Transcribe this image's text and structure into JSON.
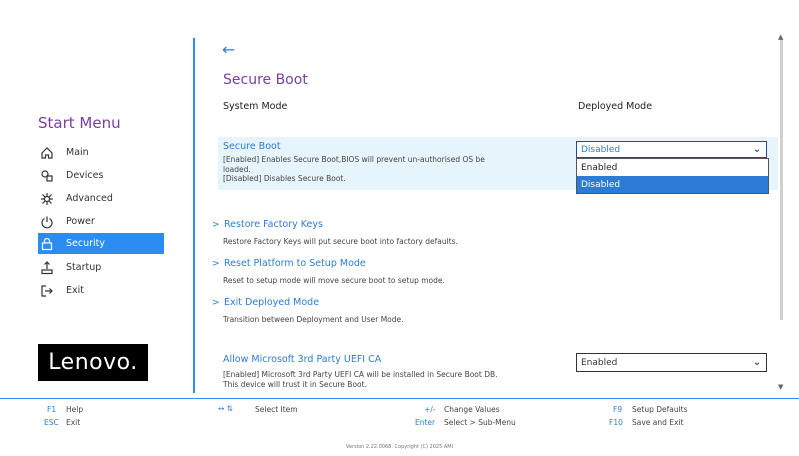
{
  "sidebar": {
    "title": "Start Menu",
    "items": [
      {
        "label": "Main",
        "icon": "home-icon"
      },
      {
        "label": "Devices",
        "icon": "devices-icon"
      },
      {
        "label": "Advanced",
        "icon": "advanced-icon"
      },
      {
        "label": "Power",
        "icon": "power-icon"
      },
      {
        "label": "Security",
        "icon": "lock-icon",
        "active": true
      },
      {
        "label": "Startup",
        "icon": "startup-icon"
      },
      {
        "label": "Exit",
        "icon": "exit-icon"
      }
    ],
    "logo_text": "Lenovo."
  },
  "header": {
    "back_glyph": "←",
    "title": "Secure Boot",
    "system_mode_label": "System Mode",
    "system_mode_value": "Deployed Mode"
  },
  "secure_boot": {
    "title": "Secure Boot",
    "desc_line1": "[Enabled] Enables Secure Boot,BIOS will prevent un-authorised OS be",
    "desc_line2": "loaded.",
    "desc_line3": "[Disabled] Disables Secure Boot.",
    "value": "Disabled",
    "options": [
      "Enabled",
      "Disabled"
    ],
    "selected_option": "Disabled"
  },
  "links": [
    {
      "title": "Restore Factory Keys",
      "desc": "Restore Factory Keys will put secure boot into factory defaults."
    },
    {
      "title": "Reset Platform to Setup Mode",
      "desc": "Reset to setup mode will move secure boot to setup mode."
    },
    {
      "title": "Exit Deployed Mode",
      "desc": "Transition between Deployment and User Mode."
    }
  ],
  "third_party": {
    "title": "Allow Microsoft 3rd Party UEFI CA",
    "desc_line1": "[Enabled] Microsoft 3rd Party UEFI CA will be installed in Secure Boot DB.",
    "desc_line2": "This device will trust it in Secure Boot.",
    "value": "Enabled"
  },
  "footer": {
    "f1_key": "F1",
    "f1_label": "Help",
    "esc_key": "ESC",
    "esc_label": "Exit",
    "arrows_key": "↔ ⇅",
    "arrows_label": "Select Item",
    "pm_key": "+/-",
    "pm_label": "Change Values",
    "enter_key": "Enter",
    "enter_label": "Select > Sub-Menu",
    "f9_key": "F9",
    "f9_label": "Setup Defaults",
    "f10_key": "F10",
    "f10_label": "Save and Exit",
    "version": "Version 2.22.0068. Copyright (C) 2025 AMI"
  },
  "colors": {
    "accent_blue": "#2c8df0",
    "title_purple": "#7a3fa3",
    "highlight_bg": "#e6f4fb"
  }
}
